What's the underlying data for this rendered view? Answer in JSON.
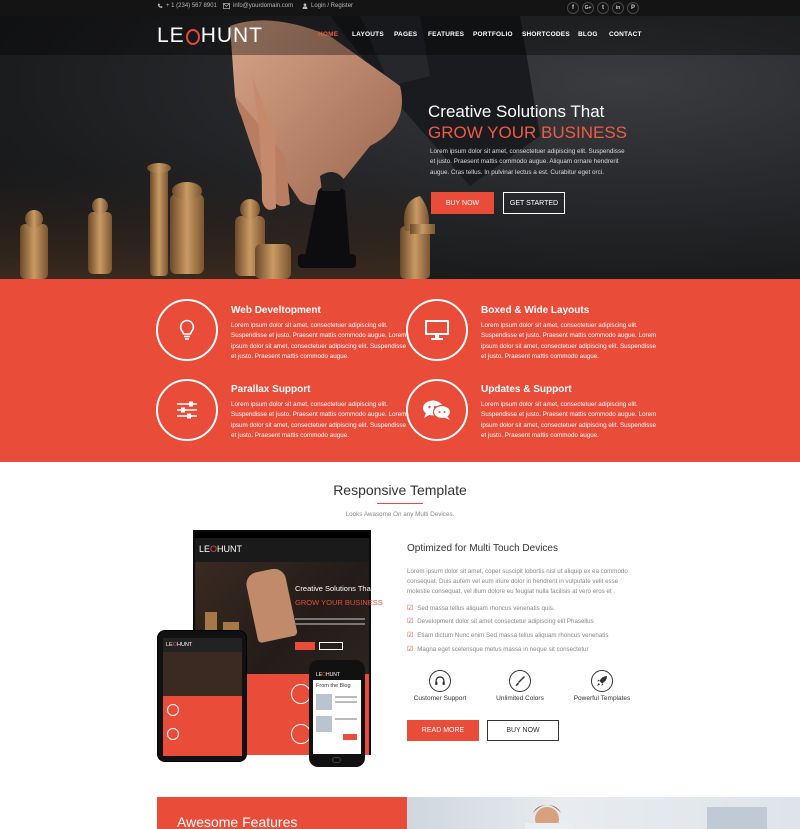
{
  "topbar": {
    "phone": "+ 1 (234) 567 8901",
    "email": "info@yourdomain.com",
    "login": "Login / Register",
    "social": [
      "f",
      "G+",
      "t",
      "in",
      "P"
    ]
  },
  "brand": {
    "logo_left": "LE",
    "logo_right": "HUNT",
    "accent": "#ea4c3a"
  },
  "nav": {
    "items": [
      "HOME",
      "LAYOUTS",
      "PAGES",
      "FEATURES",
      "PORTFOLIO",
      "SHORTCODES",
      "BLOG",
      "CONTACT"
    ]
  },
  "hero": {
    "title": "Creative Solutions That",
    "subtitle": "GROW YOUR BUSINESS",
    "text": "Lorem ipsum dolor sit amet, consectetuer adipiscing elit. Suspendisse et justo. Praesent mattis commodo augue. Aliquam ornare hendrerit augue. Cras tellus. In pulvinar lectus a est. Curabitur eget orci.",
    "btn_primary": "BUY NOW",
    "btn_secondary": "GET STARTED"
  },
  "features": [
    {
      "title": "Web Develtopment",
      "icon": "lightbulb-icon",
      "text": "Lorem ipsum dolor sit amet, consectetuer adipiscing elit. Suspendisse et justo. Praesent mattis commodo augue. Lorem ipsum dolor sit amet, consectetuer adipiscing elit. Suspendisse et justo. Praesent mattis commodo augue."
    },
    {
      "title": "Boxed & Wide Layouts",
      "icon": "monitor-icon",
      "text": "Lorem ipsum dolor sit amet, consectetuer adipiscing elit. Suspendisse et justo. Praesent mattis commodo augue. Lorem ipsum dolor sit amet, consectetuer adipiscing elit. Suspendisse et justo. Praesent mattis commodo augue."
    },
    {
      "title": "Parallax Support",
      "icon": "sliders-icon",
      "text": "Lorem ipsum dolor sit amet, consectetuer adipiscing elit. Suspendisse et justo. Praesent mattis commodo augue. Lorem ipsum dolor sit amet, consectetuer adipiscing elit. Suspendisse et justo. Praesent mattis commodo augue."
    },
    {
      "title": "Updates & Support",
      "icon": "chat-icon",
      "text": "Lorem ipsum dolor sit amet, consectetuer adipiscing elit. Suspendisse et justo. Praesent mattis commodo augue. Lorem ipsum dolor sit amet, consectetuer adipiscing elit. Suspendisse et justo. Praesent mattis commodo augue."
    }
  ],
  "responsive": {
    "title": "Responsive Template",
    "subtitle": "Looks Awasome On any Multi Devices.",
    "opt_title": "Optimized for Multi Touch Devices",
    "opt_text": "Lorem ipsum dolor sit amet, coper suscipit lobortis nisl ut aliquip ex ea commodo consequat. Duis autem vel eum iriure dolor in hendrerit in vulputate velit esse molestie consequat, vel illum dolore eu feugiat nulla facilisis at vero eros et .",
    "checklist": [
      "Sed massa tellus aliquam rhoncus venenatis quis.",
      "Development dolor sit amet consectetur adipiscing elit Phasellus",
      "Etiam dictum Nunc enim Sed massa tellus aliquam rhoncus venenatis",
      "Magna eget scelerisque metus massa in neque sit consectetur"
    ],
    "badges": [
      {
        "label": "Customer Support",
        "icon": "headset-icon"
      },
      {
        "label": "Unlimited Colors",
        "icon": "brush-icon"
      },
      {
        "label": "Powerful Templates",
        "icon": "rocket-icon"
      }
    ],
    "btn_read": "READ MORE",
    "btn_buy": "BUY NOW"
  },
  "mockup": {
    "hero_title": "Creative Solutions That",
    "hero_subtitle": "GROW YOUR BUSINESS",
    "phone_heading": "From the Blog"
  },
  "bottom": {
    "title": "Awesome Features"
  }
}
